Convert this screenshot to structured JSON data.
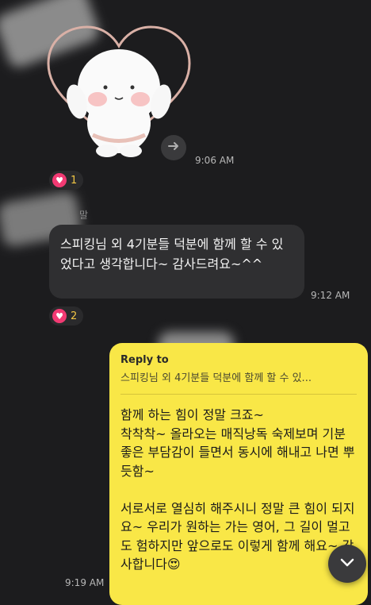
{
  "messages": {
    "sticker": {
      "time": "9:06 AM",
      "reaction_count": "1"
    },
    "incoming": {
      "sender_fragment": "말",
      "text": "스피킹님 외 4기분들 덕분에 함께 할 수 있었다고 생각합니다~ 감사드려요~^^",
      "time": "9:12 AM",
      "reaction_count": "2"
    },
    "outgoing": {
      "reply_label": "Reply to",
      "reply_preview": "스피킹님 외 4기분들 덕분에 함께 할 수 있...",
      "text": "함께 하는 힘이 정말 크죠~\n착착착~ 올라오는 매직낭독 숙제보며 기분좋은 부담감이 들면서 동시에 해내고 나면 뿌듯함~\n\n서로서로 열심히 해주시니 정말 큰 힘이 되지요~ 우리가 원하는 가는 영어, 그 길이 멀고도 험하지만 앞으로도 이렇게 함께 해요~ 감사합니다😍",
      "time": "9:19 AM"
    }
  },
  "icons": {
    "share": "arrow-right-icon",
    "reaction": "heart-icon",
    "scroll": "chevron-down-icon"
  },
  "colors": {
    "background": "#1c1c1e",
    "incoming_bubble": "#2f2f31",
    "outgoing_bubble": "#f9e747",
    "reaction_heart": "#f23a73",
    "reaction_count": "#f1c544"
  }
}
